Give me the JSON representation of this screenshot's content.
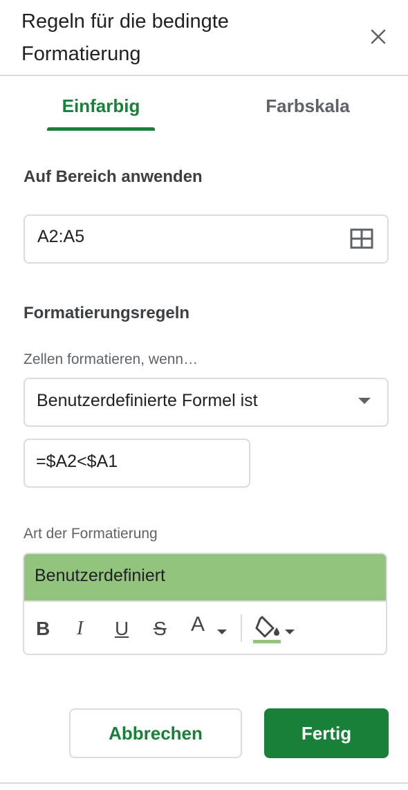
{
  "header": {
    "title": "Regeln für die bedingte Formatierung",
    "close_icon": "close-icon"
  },
  "tabs": [
    {
      "label": "Einfarbig",
      "active": true
    },
    {
      "label": "Farbskala",
      "active": false
    }
  ],
  "range_section": {
    "label": "Auf Bereich anwenden",
    "value": "A2:A5",
    "icon": "grid-select-icon"
  },
  "rules_section": {
    "label": "Formatierungsregeln",
    "condition_label": "Zellen formatieren, wenn…",
    "condition_value": "Benutzerdefinierte Formel ist",
    "formula_value": "=$A2<$A1"
  },
  "format_section": {
    "label": "Art der Formatierung",
    "preview_text": "Benutzerdefiniert",
    "preview_color": "#93c47d",
    "fill_color": "#93c47d",
    "toolbar": {
      "bold": "B",
      "italic": "I",
      "underline": "U",
      "strikethrough": "S",
      "text_color": "A"
    }
  },
  "actions": {
    "cancel_label": "Abbrechen",
    "done_label": "Fertig"
  },
  "colors": {
    "accent": "#188038",
    "divider": "#dadce0"
  }
}
